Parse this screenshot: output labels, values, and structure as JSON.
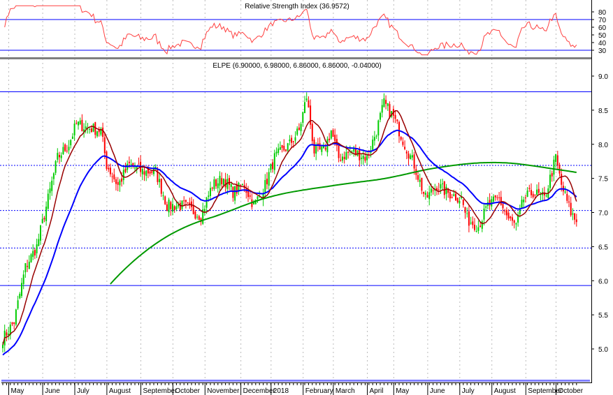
{
  "chart_data": {
    "type": "candlestick",
    "rsi_panel": {
      "title": "Relative Strength Index (36.9572)",
      "ylim": [
        20,
        90
      ],
      "ticks": [
        30,
        40,
        50,
        60,
        70,
        80
      ],
      "levels": [
        30,
        70
      ],
      "line_color": "#ff4040",
      "level_color": "#0000ff"
    },
    "price_panel": {
      "title": "ELPE (6.90000, 6.98000, 6.86000, 6.86000, -0.04000)",
      "ylim": [
        4.6,
        9.25
      ],
      "ticks": [
        "5.0",
        "5.5",
        "6.0",
        "6.5",
        "7.0",
        "7.5",
        "8.0",
        "8.5",
        "9.0"
      ],
      "solid_levels": [
        8.77,
        5.93
      ],
      "dotted_levels": [
        7.69,
        7.03,
        6.48
      ],
      "up_color": "#00cc00",
      "down_color": "#ff0000",
      "ma_colors": {
        "short": "#990000",
        "medium": "#0000ff",
        "long": "#009900"
      },
      "close_keypoints": [
        [
          0,
          5.15
        ],
        [
          6,
          5.4
        ],
        [
          12,
          6.2
        ],
        [
          18,
          6.5
        ],
        [
          24,
          7.2
        ],
        [
          29,
          7.8
        ],
        [
          35,
          8.0
        ],
        [
          39,
          8.3
        ],
        [
          44,
          8.25
        ],
        [
          52,
          8.2
        ],
        [
          55,
          7.7
        ],
        [
          61,
          7.4
        ],
        [
          67,
          7.7
        ],
        [
          74,
          7.6
        ],
        [
          81,
          7.6
        ],
        [
          87,
          7.1
        ],
        [
          96,
          7.1
        ],
        [
          105,
          6.95
        ],
        [
          111,
          7.4
        ],
        [
          117,
          7.5
        ],
        [
          122,
          7.3
        ],
        [
          128,
          7.4
        ],
        [
          133,
          7.1
        ],
        [
          139,
          7.4
        ],
        [
          144,
          7.8
        ],
        [
          152,
          8.0
        ],
        [
          157,
          8.2
        ],
        [
          161,
          8.7
        ],
        [
          165,
          7.9
        ],
        [
          170,
          7.9
        ],
        [
          174,
          8.2
        ],
        [
          178,
          7.8
        ],
        [
          185,
          7.9
        ],
        [
          193,
          7.8
        ],
        [
          198,
          8.2
        ],
        [
          202,
          8.6
        ],
        [
          207,
          8.4
        ],
        [
          213,
          8.0
        ],
        [
          218,
          7.7
        ],
        [
          224,
          7.2
        ],
        [
          230,
          7.4
        ],
        [
          235,
          7.3
        ],
        [
          243,
          7.2
        ],
        [
          246,
          6.9
        ],
        [
          252,
          6.8
        ],
        [
          257,
          7.1
        ],
        [
          263,
          7.2
        ],
        [
          268,
          6.9
        ],
        [
          272,
          6.8
        ],
        [
          276,
          7.2
        ],
        [
          281,
          7.3
        ],
        [
          287,
          7.2
        ],
        [
          293,
          7.8
        ],
        [
          296,
          7.4
        ],
        [
          301,
          7.0
        ],
        [
          304,
          6.86
        ]
      ]
    },
    "x_months": [
      {
        "label": "May",
        "bar": 5
      },
      {
        "label": "June",
        "bar": 23
      },
      {
        "label": "July",
        "bar": 40
      },
      {
        "label": "August",
        "bar": 57
      },
      {
        "label": "September",
        "bar": 75
      },
      {
        "label": "October",
        "bar": 92
      },
      {
        "label": "November",
        "bar": 109
      },
      {
        "label": "December",
        "bar": 128
      },
      {
        "label": "2018",
        "bar": 144
      },
      {
        "label": "February",
        "bar": 161
      },
      {
        "label": "March",
        "bar": 177
      },
      {
        "label": "April",
        "bar": 195
      },
      {
        "label": "May",
        "bar": 209
      },
      {
        "label": "June",
        "bar": 227
      },
      {
        "label": "July",
        "bar": 244
      },
      {
        "label": "August",
        "bar": 261
      },
      {
        "label": "September",
        "bar": 279
      },
      {
        "label": "October",
        "bar": 295
      }
    ]
  }
}
